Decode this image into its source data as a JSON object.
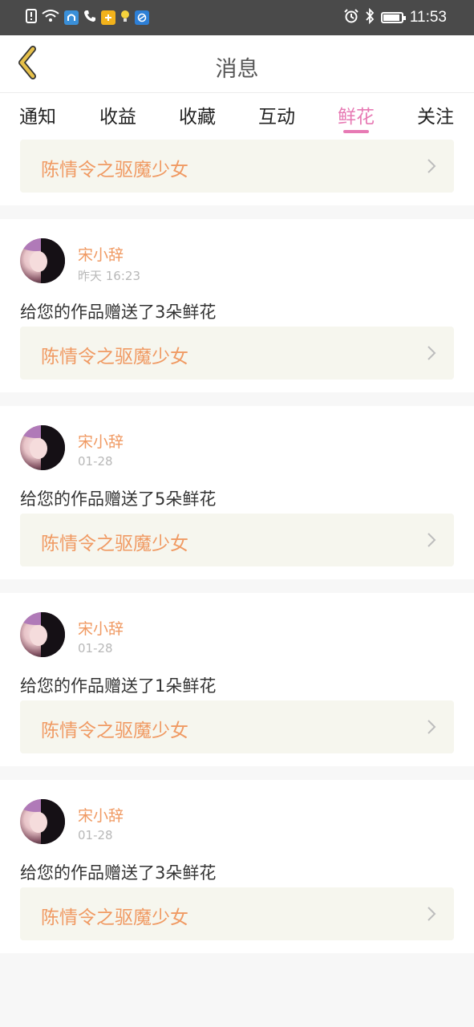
{
  "status_bar": {
    "time": "11:53",
    "left_icons": [
      "alert-icon",
      "wifi-icon",
      "app-icon-blue",
      "phone-icon",
      "app-icon-yellow",
      "bulb-icon",
      "app-icon-blue2"
    ],
    "right_icons": [
      "alarm-icon",
      "bluetooth-icon",
      "battery-icon"
    ],
    "battery_level": 0.9
  },
  "header": {
    "title": "消息",
    "back_icon": "chevron-left-icon",
    "back_color": "#e6c04a"
  },
  "tabs": [
    {
      "label": "通知",
      "active": false
    },
    {
      "label": "收益",
      "active": false
    },
    {
      "label": "收藏",
      "active": false
    },
    {
      "label": "互动",
      "active": false
    },
    {
      "label": "鲜花",
      "active": true
    },
    {
      "label": "关注",
      "active": false
    }
  ],
  "colors": {
    "accent_pink": "#e77ab4",
    "accent_orange": "#f09a63",
    "link_bg": "#f6f6ee"
  },
  "feed": {
    "top_partial": {
      "work_title": "陈情令之驱魔少女"
    },
    "items": [
      {
        "user": "宋小辞",
        "time": "昨天 16:23",
        "text": "给您的作品赠送了3朵鲜花",
        "work_title": "陈情令之驱魔少女"
      },
      {
        "user": "宋小辞",
        "time": "01-28",
        "text": "给您的作品赠送了5朵鲜花",
        "work_title": "陈情令之驱魔少女"
      },
      {
        "user": "宋小辞",
        "time": "01-28",
        "text": "给您的作品赠送了1朵鲜花",
        "work_title": "陈情令之驱魔少女"
      },
      {
        "user": "宋小辞",
        "time": "01-28",
        "text": "给您的作品赠送了3朵鲜花",
        "work_title": "陈情令之驱魔少女"
      }
    ]
  }
}
